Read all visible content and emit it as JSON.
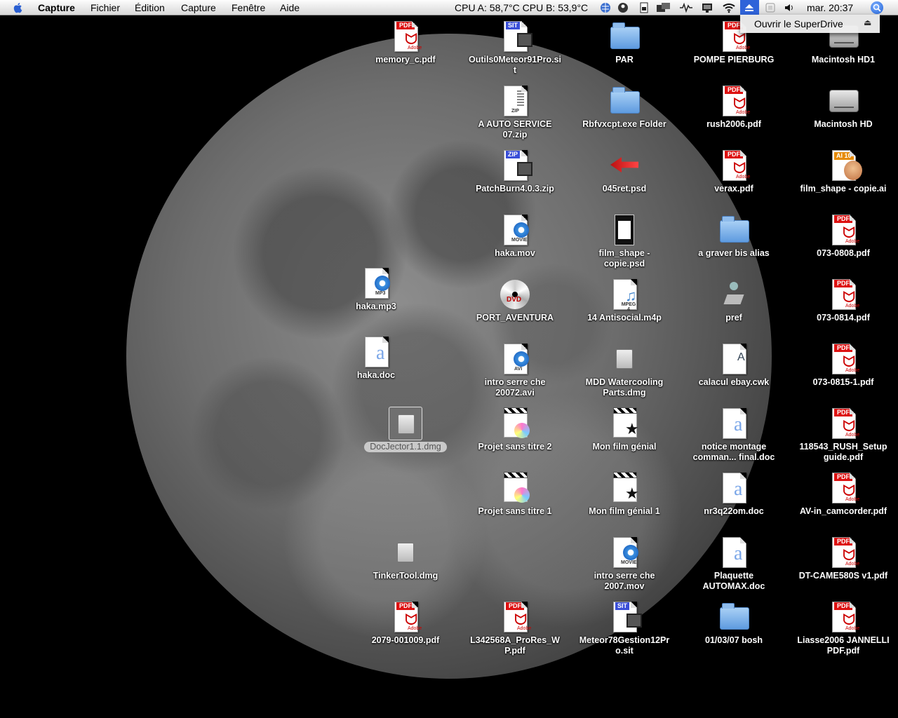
{
  "menubar": {
    "app_name": "Capture",
    "menus": [
      "Fichier",
      "Édition",
      "Capture",
      "Fenêtre",
      "Aide"
    ],
    "cpu_status": "CPU A: 58,7°C CPU B: 53,9°C",
    "clock": "mar. 20:37",
    "status_icons": [
      "globe-icon",
      "sync-icon",
      "sim-card-icon",
      "displays-icon",
      "network-activity-icon",
      "monitor-icon",
      "wifi-icon",
      "eject-icon",
      "script-icon",
      "volume-icon",
      "spotlight-icon"
    ]
  },
  "eject_menu": {
    "item": "Ouvrir le SuperDrive",
    "symbol": "⏏"
  },
  "desktop": {
    "icons": [
      {
        "label": "memory_c.pdf",
        "type": "pdf"
      },
      {
        "label": "Outils0Meteor91Pro.sit",
        "type": "sit"
      },
      {
        "label": "PAR",
        "type": "folder"
      },
      {
        "label": "POMPE PIERBURG",
        "type": "pdf"
      },
      {
        "label": "Macintosh HD1",
        "type": "disk"
      },
      {
        "label": "A AUTO SERVICE 07.zip",
        "type": "zip"
      },
      {
        "label": "Rbfvxcpt.exe Folder",
        "type": "folder"
      },
      {
        "label": "rush2006.pdf",
        "type": "pdf"
      },
      {
        "label": "Macintosh HD",
        "type": "disk"
      },
      {
        "label": "PatchBurn4.0.3.zip",
        "type": "sitzip"
      },
      {
        "label": "045ret.psd",
        "type": "psd"
      },
      {
        "label": "verax.pdf",
        "type": "pdf"
      },
      {
        "label": "film_shape - copie.ai",
        "type": "ai"
      },
      {
        "label": "haka.mov",
        "type": "mov"
      },
      {
        "label": "film_shape - copie.psd",
        "type": "film"
      },
      {
        "label": "a graver bis alias",
        "type": "folder"
      },
      {
        "label": "073-0808.pdf",
        "type": "pdf"
      },
      {
        "label": "haka.mp3",
        "type": "mp3"
      },
      {
        "label": "PORT_AVENTURA",
        "type": "dvd"
      },
      {
        "label": "14 Antisocial.m4p",
        "type": "m4p"
      },
      {
        "label": "pref",
        "type": "pref"
      },
      {
        "label": "073-0814.pdf",
        "type": "pdf"
      },
      {
        "label": "haka.doc",
        "type": "doc"
      },
      {
        "label": "intro serre che 20072.avi",
        "type": "avi"
      },
      {
        "label": "MDD Watercooling Parts.dmg",
        "type": "dmg"
      },
      {
        "label": "calacul ebay.cwk",
        "type": "cwk"
      },
      {
        "label": "073-0815-1.pdf",
        "type": "pdf"
      },
      {
        "label": "DocJector1.1.dmg",
        "type": "dmg",
        "selected": true
      },
      {
        "label": "Projet sans titre 2",
        "type": "imovie"
      },
      {
        "label": "Mon film génial",
        "type": "idvd"
      },
      {
        "label": "notice montage comman... final.doc",
        "type": "doc"
      },
      {
        "label": "118543_RUSH_Setupguide.pdf",
        "type": "pdf"
      },
      {
        "label": "Projet sans titre 1",
        "type": "imovie"
      },
      {
        "label": "Mon film génial 1",
        "type": "idvd"
      },
      {
        "label": "nr3q22om.doc",
        "type": "doc"
      },
      {
        "label": "AV-in_camcorder.pdf",
        "type": "pdf"
      },
      {
        "label": "TinkerTool.dmg",
        "type": "dmg"
      },
      {
        "label": "intro serre che 2007.mov",
        "type": "mov"
      },
      {
        "label": "Plaquette AUTOMAX.doc",
        "type": "doc"
      },
      {
        "label": "DT-CAME580S v1.pdf",
        "type": "pdf"
      },
      {
        "label": "2079-001009.pdf",
        "type": "pdf"
      },
      {
        "label": "L342568A_ProRes_WP.pdf",
        "type": "pdf"
      },
      {
        "label": "Meteor78Gestion12Pro.sit",
        "type": "sit"
      },
      {
        "label": "01/03/07 bosh",
        "type": "folder"
      },
      {
        "label": "Liasse2006 JANNELLI PDF.pdf",
        "type": "pdf"
      }
    ]
  },
  "icon_text": {
    "pdf": "PDF",
    "adobe": "Adobe",
    "sit": "SIT",
    "zip": "ZIP",
    "dvd": "DVD",
    "ai": "AI 10",
    "mov": "MOVIE",
    "mp3": "MP3",
    "avi": "AVI",
    "m4p": "MPEG 4",
    "zipfile": "ZIP"
  },
  "colors": {
    "accent": "#2f63d9",
    "pdf_red": "#d11111",
    "desktop_bg": "#000000"
  }
}
